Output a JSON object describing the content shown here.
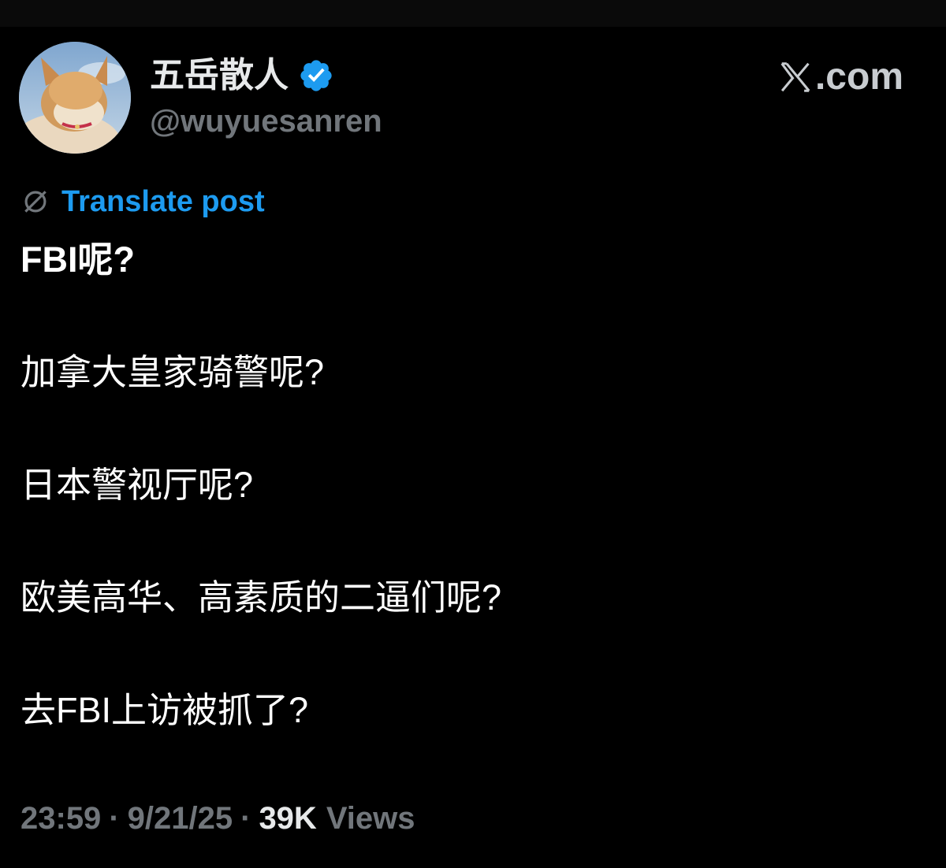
{
  "author": {
    "display_name": "五岳散人",
    "handle": "@wuyuesanren",
    "verified": true,
    "avatar_icon": "cat-avatar"
  },
  "brand": {
    "text": ".com",
    "icon": "x-logo-icon"
  },
  "translate": {
    "label": "Translate post",
    "icon": "globe-icon"
  },
  "post": {
    "lines": [
      "FBI呢?",
      "加拿大皇家骑警呢?",
      "日本警视厅呢?",
      "欧美高华、高素质的二逼们呢?",
      "去FBI上访被抓了?"
    ]
  },
  "meta": {
    "time": "23:59",
    "date": "9/21/25",
    "separator": "·",
    "views_count": "39K",
    "views_label": "Views"
  },
  "colors": {
    "background": "#000000",
    "primary_text": "#e7e9ea",
    "muted_text": "#71767b",
    "link": "#1d9bf0",
    "verified_badge": "#1d9bf0"
  }
}
